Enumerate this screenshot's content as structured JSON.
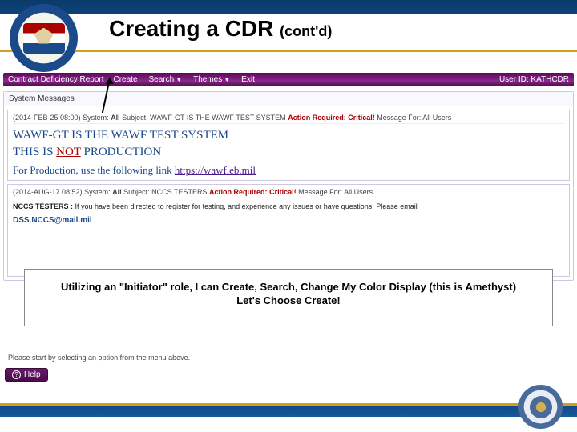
{
  "slide": {
    "title_main": "Creating a CDR ",
    "title_contd": "(cont'd)"
  },
  "menubar": {
    "app_label": "Contract Deficiency Report",
    "items": [
      {
        "label": "Create",
        "has_caret": false
      },
      {
        "label": "Search",
        "has_caret": true
      },
      {
        "label": "Themes",
        "has_caret": true
      },
      {
        "label": "Exit",
        "has_caret": false
      }
    ],
    "user_prefix": "User ID: ",
    "user_id": "KATHCDR"
  },
  "system_messages": {
    "header": "System Messages",
    "msg1": {
      "meta_date": "(2014-FEB-25 08:00)",
      "meta_system_lbl": "System:",
      "meta_system_val": "All",
      "meta_subject_lbl": "Subject:",
      "meta_subject_val": "WAWF-GT IS THE WAWF TEST SYSTEM",
      "meta_action_lbl": "Action Required:",
      "meta_action_val": "Critical!",
      "meta_for": "Message For: All Users",
      "line1_a": "WAWF-GT IS THE WAWF TEST SYSTEM",
      "line2_a": "THIS IS ",
      "line2_not": "NOT",
      "line2_b": " PRODUCTION",
      "line3": "For Production, use the following link ",
      "link": "https://wawf.eb.mil"
    },
    "msg2": {
      "meta_date": "(2014-AUG-17 08:52)",
      "meta_system_lbl": "System:",
      "meta_system_val": "All",
      "meta_subject_lbl": "Subject:",
      "meta_subject_val": "NCCS TESTERS",
      "meta_action_lbl": "Action Required:",
      "meta_action_val": "Critical!",
      "meta_for": "Message For: All Users",
      "body_bold": "NCCS TESTERS :",
      "body_rest": " If you have been directed to register for testing, and experience any issues or have questions. Please email",
      "email": "DSS.NCCS@mail.mil"
    }
  },
  "callout": {
    "line1": "Utilizing an \"Initiator\" role,  I can Create, Search, Change My Color Display (this is Amethyst)",
    "line2": "Let's Choose Create!"
  },
  "instruction": "Please start by selecting an option from the menu above.",
  "help_label": "Help"
}
